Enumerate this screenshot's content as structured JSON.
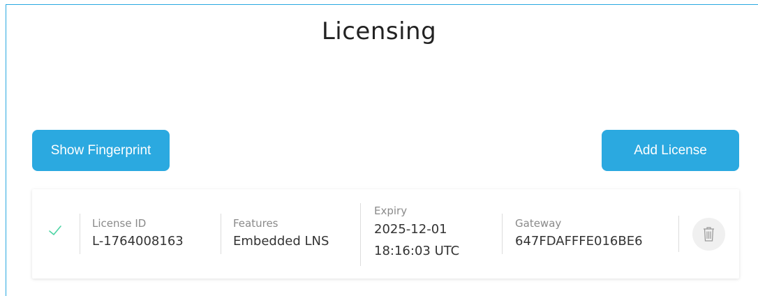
{
  "page": {
    "title": "Licensing"
  },
  "toolbar": {
    "show_fingerprint_label": "Show Fingerprint",
    "add_license_label": "Add License"
  },
  "licenses": [
    {
      "status": "valid",
      "status_icon": "checkmark-icon",
      "license_id_label": "License ID",
      "license_id": "L-1764008163",
      "features_label": "Features",
      "features": "Embedded LNS",
      "expiry_label": "Expiry",
      "expiry_date": "2025-12-01",
      "expiry_time": "18:16:03 UTC",
      "gateway_label": "Gateway",
      "gateway": "647FDAFFFE016BE6",
      "delete_icon": "trash-icon"
    }
  ],
  "colors": {
    "accent": "#2ba9e0",
    "success": "#4cd4a4",
    "frame_border": "#29a8e0"
  }
}
